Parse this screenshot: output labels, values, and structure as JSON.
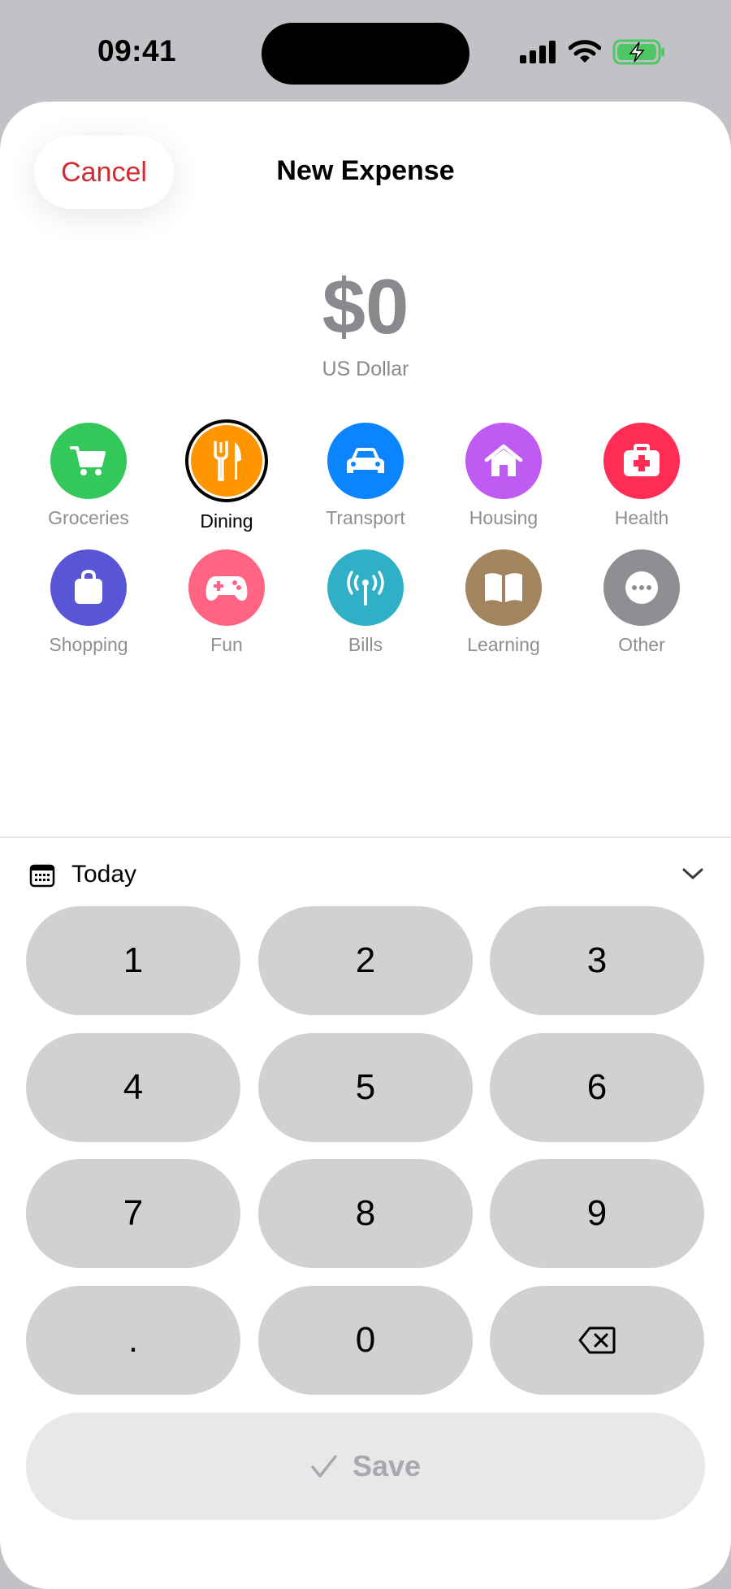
{
  "status_bar": {
    "time": "09:41"
  },
  "header": {
    "cancel_label": "Cancel",
    "title": "New Expense"
  },
  "amount": {
    "value": "$0",
    "currency": "US Dollar"
  },
  "categories": [
    {
      "label": "Groceries",
      "icon": "cart-icon",
      "color": "#34c759",
      "selected": false
    },
    {
      "label": "Dining",
      "icon": "fork-knife-icon",
      "color": "#ff9500",
      "selected": true
    },
    {
      "label": "Transport",
      "icon": "car-icon",
      "color": "#0a84ff",
      "selected": false
    },
    {
      "label": "Housing",
      "icon": "house-icon",
      "color": "#bf5af2",
      "selected": false
    },
    {
      "label": "Health",
      "icon": "medical-bag-icon",
      "color": "#ff2d55",
      "selected": false
    },
    {
      "label": "Shopping",
      "icon": "shopping-bag-icon",
      "color": "#5856d6",
      "selected": false
    },
    {
      "label": "Fun",
      "icon": "gamepad-icon",
      "color": "#ff6482",
      "selected": false
    },
    {
      "label": "Bills",
      "icon": "antenna-icon",
      "color": "#30b0c7",
      "selected": false
    },
    {
      "label": "Learning",
      "icon": "book-icon",
      "color": "#a2845e",
      "selected": false
    },
    {
      "label": "Other",
      "icon": "ellipsis-icon",
      "color": "#8e8e93",
      "selected": false
    }
  ],
  "date": {
    "label": "Today"
  },
  "keypad": {
    "keys": [
      "1",
      "2",
      "3",
      "4",
      "5",
      "6",
      "7",
      "8",
      "9",
      ".",
      "0"
    ]
  },
  "save": {
    "label": "Save"
  }
}
